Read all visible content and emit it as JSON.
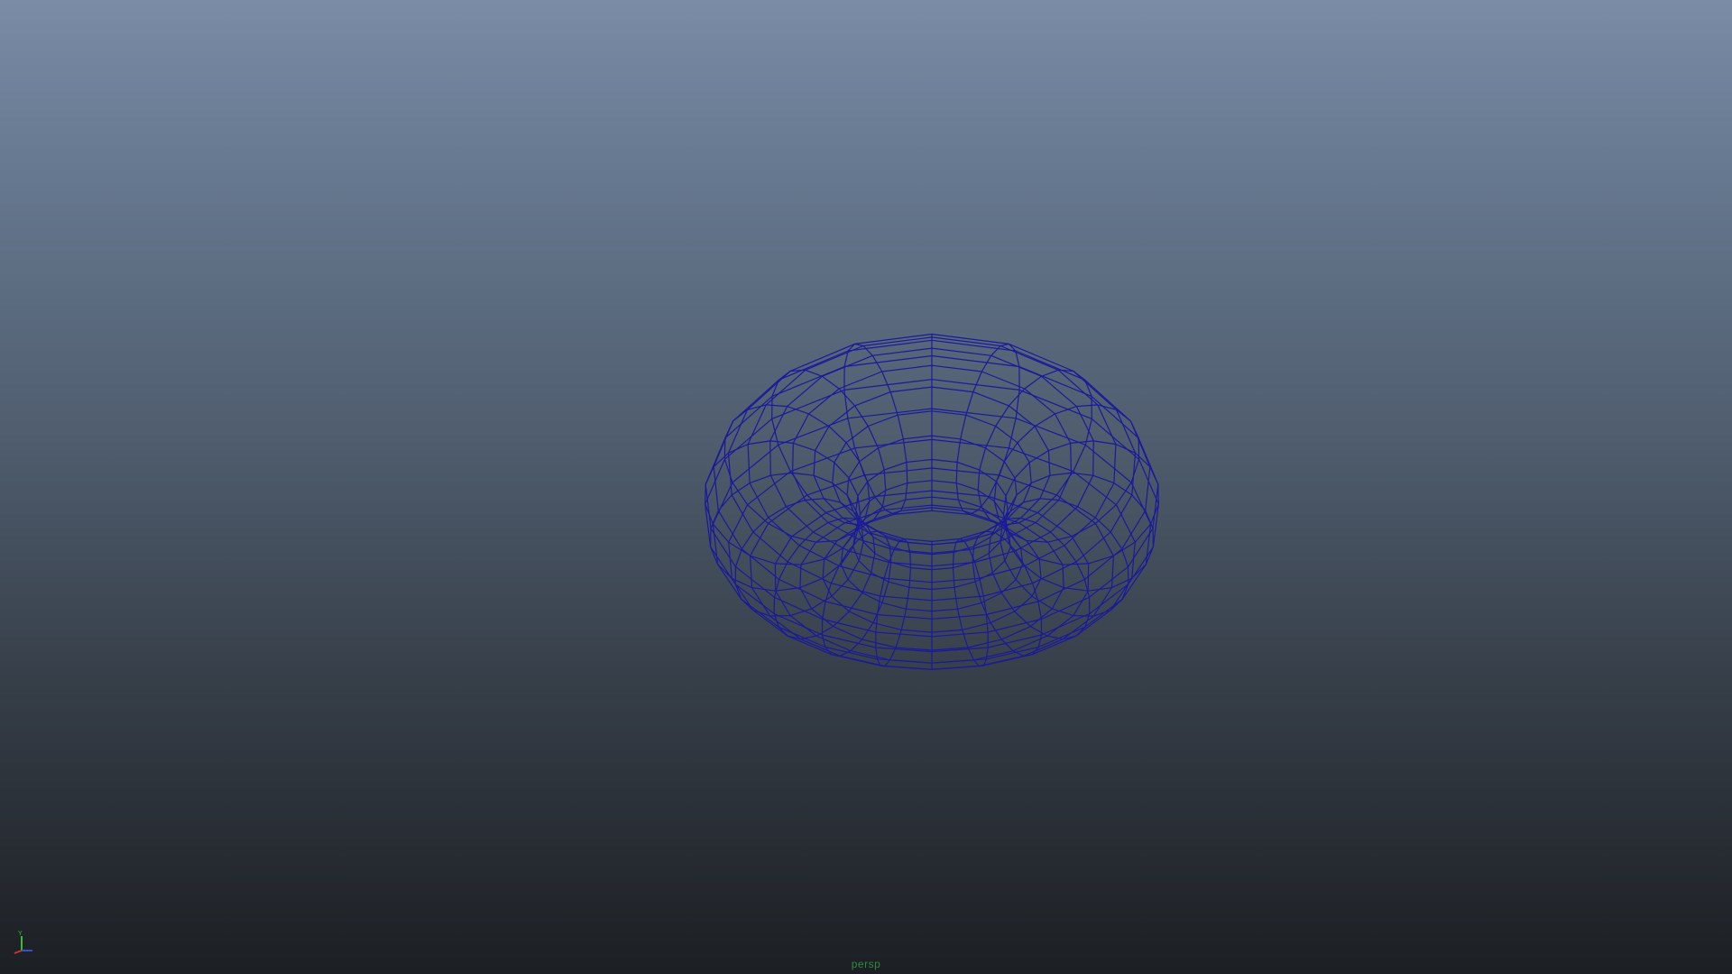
{
  "viewport": {
    "camera_name": "persp",
    "shading_mode": "wireframe"
  },
  "object": {
    "type": "torus",
    "wire_color": "#1a1a9a",
    "major_segments": 20,
    "minor_segments": 20
  },
  "axis_gizmo": {
    "x_label": "X",
    "y_label": "Y",
    "z_label": "Z",
    "x_color": "#d03030",
    "y_color": "#30c030",
    "z_color": "#3050e0"
  },
  "colors": {
    "background_top": "#7a8ca6",
    "background_bottom": "#1c1f23",
    "camera_label": "#2f8a3a"
  }
}
